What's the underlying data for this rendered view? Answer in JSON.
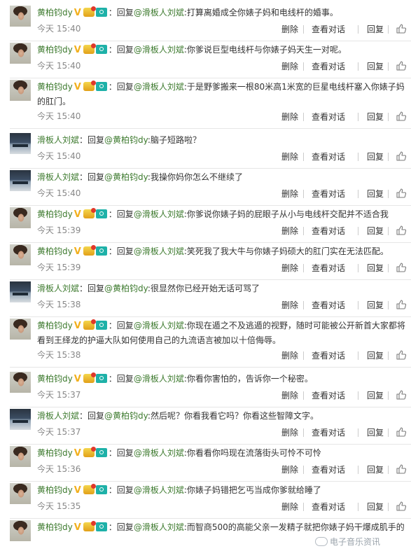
{
  "actions": {
    "delete": "删除",
    "view_conversation": "查看对话",
    "reply": "回复"
  },
  "reply_prefix": "：回复",
  "colon": ":",
  "comments": [
    {
      "user": "黄柏钧dy",
      "badges": true,
      "mention": "@滑板人刘斌",
      "text": "打算离婚成全你婊子妈和电线杆的婚事。",
      "time": "今天 15:40"
    },
    {
      "user": "黄柏钧dy",
      "badges": true,
      "mention": "@滑板人刘斌",
      "text": "你爹说巨型电线杆与你婊子妈天生一对呢。",
      "time": "今天 15:40"
    },
    {
      "user": "黄柏钧dy",
      "badges": true,
      "mention": "@滑板人刘斌",
      "text": "于是野爹搬来一根80米高1米宽的巨星电线杆塞入你婊子妈的肛门。",
      "time": "今天 15:40"
    },
    {
      "user": "滑板人刘斌",
      "badges": false,
      "mention": "@黄柏钧dy",
      "text": "脑子短路啦？",
      "time": "今天 15:40"
    },
    {
      "user": "滑板人刘斌",
      "badges": false,
      "mention": "@黄柏钧dy",
      "text": "我操你妈你怎么不继续了",
      "time": "今天 15:40"
    },
    {
      "user": "黄柏钧dy",
      "badges": true,
      "mention": "@滑板人刘斌",
      "text": "你爹说你婊子妈的屁眼子从小与电线杆交配并不适合我",
      "time": "今天 15:39"
    },
    {
      "user": "黄柏钧dy",
      "badges": true,
      "mention": "@滑板人刘斌",
      "text": "笑死我了我大牛与你婊子妈硕大的肛门实在无法匹配。",
      "time": "今天 15:39"
    },
    {
      "user": "滑板人刘斌",
      "badges": false,
      "mention": "@黄柏钧dy",
      "text": "很显然你已经开始无话可骂了",
      "time": "今天 15:38"
    },
    {
      "user": "黄柏钧dy",
      "badges": true,
      "mention": "@滑板人刘斌",
      "text": "你现在遁之不及逃遁的视野，随时可能被公开新首大家都将看到王绎龙的护逼大队如何使用自己的九流语言被加以十倍侮辱。",
      "time": "今天 15:38"
    },
    {
      "user": "黄柏钧dy",
      "badges": true,
      "mention": "@滑板人刘斌",
      "text": "你看你害怕的，告诉你一个秘密。",
      "time": "今天 15:37"
    },
    {
      "user": "滑板人刘斌",
      "badges": false,
      "mention": "@黄柏钧dy",
      "text": "然后呢？你看我看它吗？你看这些智障文字。",
      "time": "今天 15:37"
    },
    {
      "user": "黄柏钧dy",
      "badges": true,
      "mention": "@滑板人刘斌",
      "text": "你看看你吗现在流落街头可怜不可怜",
      "time": "今天 15:36"
    },
    {
      "user": "黄柏钧dy",
      "badges": true,
      "mention": "@滑板人刘斌",
      "text": "你婊子妈错把乞丐当成你爹就给睡了",
      "time": "今天 15:35"
    },
    {
      "user": "黄柏钧dy",
      "badges": true,
      "mention": "@滑板人刘斌",
      "text": "而智商500的高能父亲一发精子就把你婊子妈干爆成肌手的",
      "time": ""
    }
  ],
  "watermark": "电子音乐资讯"
}
